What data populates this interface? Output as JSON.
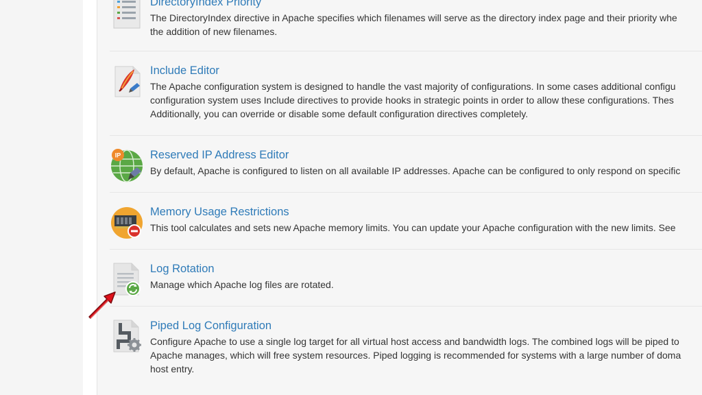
{
  "colors": {
    "link": "#2f7bb8",
    "text": "#333333",
    "accent_arrow": "#e0101a"
  },
  "items": [
    {
      "title": "DirectoryIndex Priority",
      "icon": "directory-list-icon",
      "lines": [
        "The DirectoryIndex directive in Apache specifies which filenames will serve as the directory index page and their priority whe",
        "the addition of new filenames."
      ]
    },
    {
      "title": "Include Editor",
      "icon": "include-editor-feather-icon",
      "lines": [
        "The Apache configuration system is designed to handle the vast majority of configurations. In some cases additional configu",
        "configuration system uses Include directives to provide hooks in strategic points in order to allow these configurations. Thes",
        "Additionally, you can override or disable some default configuration directives completely."
      ]
    },
    {
      "title": "Reserved IP Address Editor",
      "icon": "globe-ip-icon",
      "lines": [
        "By default, Apache is configured to listen on all available IP addresses. Apache can be configured to only respond on specific"
      ]
    },
    {
      "title": "Memory Usage Restrictions",
      "icon": "memory-chip-icon",
      "lines": [
        "This tool calculates and sets new Apache memory limits. You can update your Apache configuration with the new limits. See"
      ]
    },
    {
      "title": "Log Rotation",
      "icon": "log-rotation-icon",
      "lines": [
        "Manage which Apache log files are rotated."
      ]
    },
    {
      "title": "Piped Log Configuration",
      "icon": "piped-log-icon",
      "lines": [
        "Configure Apache to use a single log target for all virtual host access and bandwidth logs. The combined logs will be piped to",
        "Apache manages, which will free system resources. Piped logging is recommended for systems with a large number of doma",
        "host entry."
      ]
    }
  ]
}
